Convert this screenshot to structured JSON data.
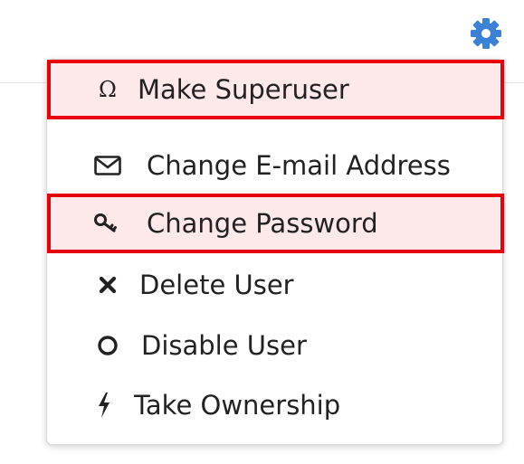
{
  "header": {
    "settings_icon": "gear-icon",
    "accent_color": "#3b82d6"
  },
  "menu": {
    "items": [
      {
        "label": "Make Superuser",
        "icon": "omega-icon",
        "highlighted": true
      },
      {
        "label": "Change E-mail Address",
        "icon": "envelope-icon",
        "highlighted": false
      },
      {
        "label": "Change Password",
        "icon": "key-icon",
        "highlighted": true
      },
      {
        "label": "Delete User",
        "icon": "x-icon",
        "highlighted": false
      },
      {
        "label": "Disable User",
        "icon": "circle-icon",
        "highlighted": false
      },
      {
        "label": "Take Ownership",
        "icon": "lightning-bolt-icon",
        "highlighted": false
      }
    ],
    "highlight_border_color": "#e8000b",
    "highlight_fill_color": "#fde8ea"
  }
}
